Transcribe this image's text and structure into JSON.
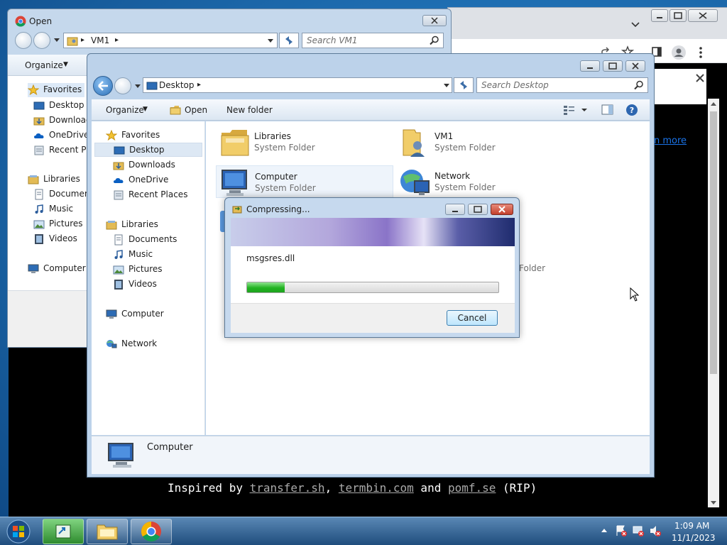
{
  "browser": {
    "learn_more": "n more",
    "inspired": {
      "prefix": "Inspired by ",
      "link1": "transfer.sh",
      "sep1": ", ",
      "link2": "termbin.com",
      "sep2": " and ",
      "link3": "pomf.se",
      "suffix": " (RIP)"
    }
  },
  "open_dialog": {
    "title": "Open",
    "breadcrumb": "VM1",
    "search_placeholder": "Search VM1",
    "organize": "Organize",
    "nav": [
      {
        "label": "Favorites",
        "icon": "star-icon"
      },
      {
        "label": "Desktop",
        "icon": "desktop-icon"
      },
      {
        "label": "Download",
        "icon": "downloads-icon"
      },
      {
        "label": "OneDrive",
        "icon": "onedrive-icon"
      },
      {
        "label": "Recent Pla",
        "icon": "recent-places-icon"
      },
      {
        "label": "Libraries",
        "icon": "libraries-icon"
      },
      {
        "label": "Documen",
        "icon": "documents-icon"
      },
      {
        "label": "Music",
        "icon": "music-icon"
      },
      {
        "label": "Pictures",
        "icon": "pictures-icon"
      },
      {
        "label": "Videos",
        "icon": "videos-icon"
      },
      {
        "label": "Computer",
        "icon": "computer-icon"
      }
    ]
  },
  "explorer": {
    "breadcrumb": "Desktop",
    "search_placeholder": "Search Desktop",
    "toolbar": {
      "organize": "Organize",
      "open": "Open",
      "new_folder": "New folder"
    },
    "nav": [
      {
        "label": "Favorites",
        "icon": "star-icon"
      },
      {
        "label": "Desktop",
        "icon": "desktop-icon"
      },
      {
        "label": "Downloads",
        "icon": "downloads-icon"
      },
      {
        "label": "OneDrive",
        "icon": "onedrive-icon"
      },
      {
        "label": "Recent Places",
        "icon": "recent-places-icon"
      },
      {
        "label": "Libraries",
        "icon": "libraries-icon"
      },
      {
        "label": "Documents",
        "icon": "documents-icon"
      },
      {
        "label": "Music",
        "icon": "music-icon"
      },
      {
        "label": "Pictures",
        "icon": "pictures-icon"
      },
      {
        "label": "Videos",
        "icon": "videos-icon"
      },
      {
        "label": "Computer",
        "icon": "computer-icon"
      },
      {
        "label": "Network",
        "icon": "network-icon"
      }
    ],
    "items": [
      {
        "name": "Libraries",
        "type": "System Folder",
        "icon": "libraries-folder-icon"
      },
      {
        "name": "VM1",
        "type": "System Folder",
        "icon": "user-folder-icon"
      },
      {
        "name": "Computer",
        "type": "System Folder",
        "icon": "computer-icon"
      },
      {
        "name": "Network",
        "type": "System Folder",
        "icon": "network-icon"
      }
    ],
    "partial_item_type": "Folder",
    "details_name": "Computer"
  },
  "compress_dialog": {
    "title": "Compressing...",
    "filename": "msgsres.dll",
    "progress": 0.15,
    "cancel": "Cancel"
  },
  "taskbar": {
    "time": "1:09 AM",
    "date": "11/1/2023"
  },
  "colors": {
    "accent": "#1a73e8",
    "progress": "#22b322",
    "desktop": "#1f6fb3"
  }
}
